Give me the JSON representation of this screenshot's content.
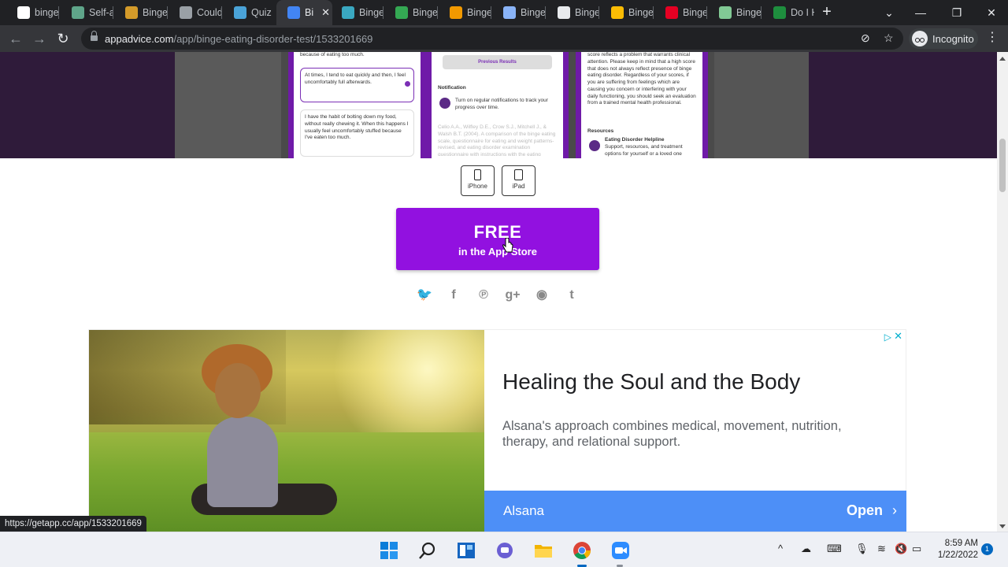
{
  "browser": {
    "tabs": [
      {
        "title": "binge",
        "favicon": "google-icon",
        "color": "#ffffff"
      },
      {
        "title": "Self-a",
        "favicon": "globe-icon",
        "color": "#5fa58a"
      },
      {
        "title": "Binge",
        "favicon": "book-icon",
        "color": "#d49b2a"
      },
      {
        "title": "Could",
        "favicon": "ed-icon",
        "color": "#9aa0a6"
      },
      {
        "title": "Quiz F",
        "favicon": "heart-icon",
        "color": "#4aa3d8"
      },
      {
        "title": "Bi",
        "favicon": "appadvice-icon",
        "color": "#4285f4"
      },
      {
        "title": "Binge",
        "favicon": "wave-icon",
        "color": "#3aa8c1"
      },
      {
        "title": "Binge",
        "favicon": "a-icon",
        "color": "#34a853"
      },
      {
        "title": "Binge",
        "favicon": "chart-icon",
        "color": "#f29900"
      },
      {
        "title": "Binge",
        "favicon": "image-icon",
        "color": "#8ab4f8"
      },
      {
        "title": "Binge",
        "favicon": "pulse-icon",
        "color": "#e8eaed"
      },
      {
        "title": "Binge",
        "favicon": "cup-icon",
        "color": "#fbbc04"
      },
      {
        "title": "Binge",
        "favicon": "pinterest-icon",
        "color": "#e60023"
      },
      {
        "title": "Binge",
        "favicon": "tree-icon",
        "color": "#81c995"
      },
      {
        "title": "Do I H",
        "favicon": "leaf-icon",
        "color": "#1e8e3e"
      }
    ],
    "active_tab_close": "✕",
    "new_tab": "+",
    "url_host": "appadvice.com",
    "url_path": "/app/binge-eating-disorder-test/1533201669",
    "incognito_label": "Incognito",
    "status_url": "https://getapp.cc/app/1533201669"
  },
  "page": {
    "screenshots": [
      {
        "top_text": "because of eating too much.",
        "selected_text": "At times, I tend to eat quickly and then, I feel uncomfortably full afterwards.",
        "bottom_text": "I have the habit of bolting down my food, without really chewing it. When this happens I usually feel uncomfortably stuffed because I've eaten too much."
      },
      {
        "button": "Previous Results",
        "heading": "Notification",
        "notif_text": "Turn on regular notifications to track your progress over time.",
        "faint_text": "Celio A.A., Wilfley D.E., Crow S.J., Mitchell J., & Walsh B.T. (2004). A comparison of the binge eating scale, questionnaire for eating and weight patterns-revised, and eating disorder examination questionnaire with instructions with the eating disorder examination in the assessment of binge eating disorder and its symptoms."
      },
      {
        "body_text": "score reflects a problem that warrants clinical attention. Please keep in mind that a high score that does not always reflect presence of binge eating disorder. Regardless of your scores, if you are suffering from feelings which are causing you concern or interfering with your daily functioning, you should seek an evaluation from a trained mental health professional.",
        "resources_heading": "Resources",
        "helpline_title": "Eating Disorder Helpline",
        "helpline_text": "Support, resources, and treatment options for yourself or a loved one"
      }
    ],
    "device_buttons": [
      {
        "label": "iPhone"
      },
      {
        "label": "iPad"
      }
    ],
    "cta": {
      "big": "FREE",
      "small": "in the App Store",
      "color": "#9211e0"
    },
    "share_icons": [
      "twitter-icon",
      "facebook-icon",
      "pinterest-icon",
      "google-plus-icon",
      "reddit-icon",
      "tumblr-icon"
    ],
    "share_glyphs": [
      "🐦",
      "f",
      "℗",
      "g+",
      "◉",
      "t"
    ],
    "ad": {
      "title": "Healing the Soul and the Body",
      "description": "Alsana's approach combines medical, movement, nutrition, therapy, and relational support.",
      "brand": "Alsana",
      "open_label": "Open",
      "bar_color": "#4d8ff7"
    }
  },
  "taskbar": {
    "time": "8:59 AM",
    "date": "1/22/2022",
    "notification_count": "1",
    "apps": [
      "windows-start-icon",
      "search-icon",
      "widgets-icon",
      "chat-icon",
      "file-explorer-icon",
      "chrome-icon",
      "zoom-icon"
    ]
  }
}
